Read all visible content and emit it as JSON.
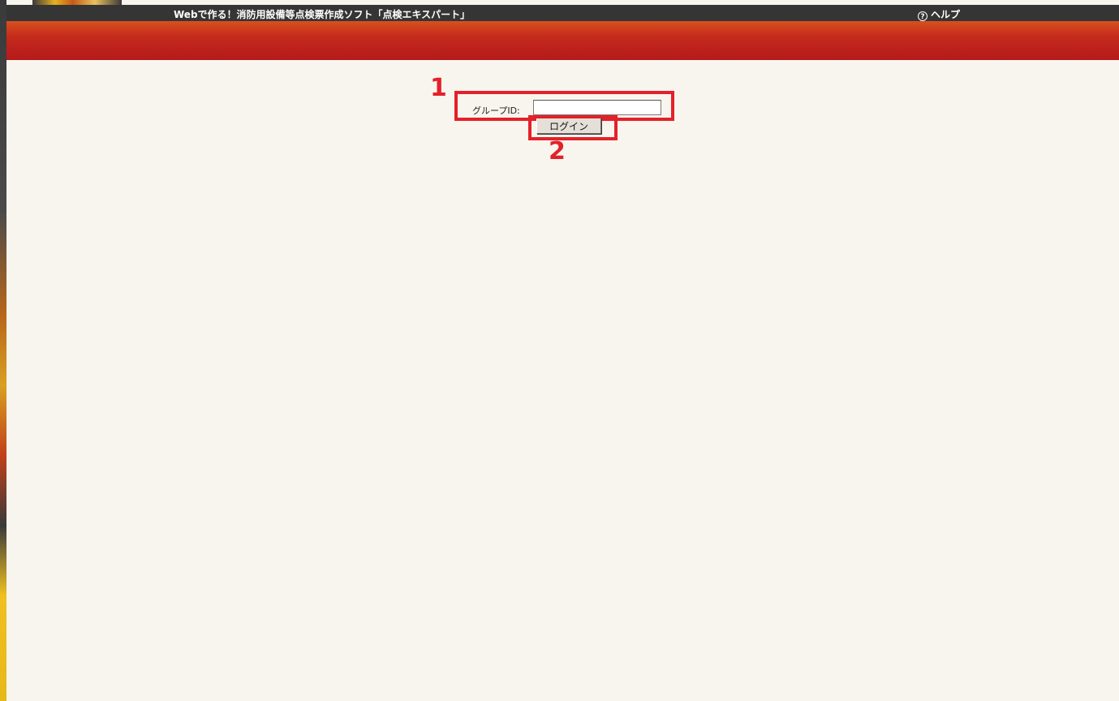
{
  "header": {
    "title": "Webで作る！消防用設備等点検票作成ソフト「点検エキスパート」",
    "help_label": "ヘルプ",
    "help_icon": "?"
  },
  "login_form": {
    "group_id_label": "グループID:",
    "group_id_value": "",
    "login_button_label": "ログイン"
  },
  "annotations": {
    "marker_1": "1",
    "marker_2": "2",
    "highlight_color": "#e32129"
  },
  "colors": {
    "top_bar": "#353535",
    "red_band": "#b51a1a",
    "background": "#f8f5ee"
  }
}
